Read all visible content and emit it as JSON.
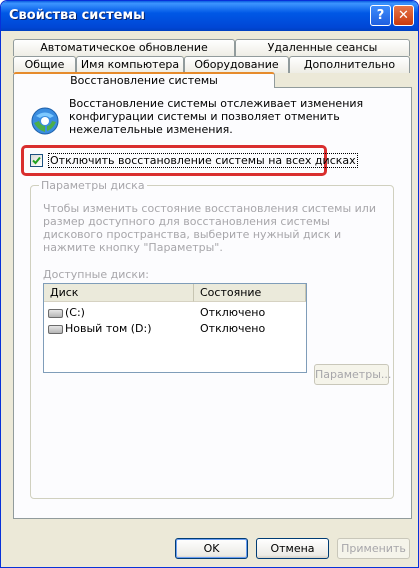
{
  "window": {
    "title": "Свойства системы",
    "help_glyph": "?",
    "close_glyph": "✕"
  },
  "tabs": {
    "row1": [
      "Автоматическое обновление",
      "Удаленные сеансы"
    ],
    "row2": [
      "Общие",
      "Имя компьютера",
      "Оборудование",
      "Дополнительно"
    ],
    "active": "Восстановление системы"
  },
  "panel": {
    "intro_text": "Восстановление системы отслеживает изменения конфигурации системы и позволяет отменить нежелательные изменения.",
    "disable_checkbox": {
      "label": "Отключить восстановление системы на всех дисках",
      "checked": true
    },
    "disk_group": {
      "title": "Параметры диска",
      "description": "Чтобы изменить состояние восстановления системы или размер доступного для восстановления системы дискового пространства, выберите нужный диск и нажмите кнопку \"Параметры\".",
      "available_label": "Доступные диски:",
      "columns": [
        "Диск",
        "Состояние"
      ],
      "rows": [
        {
          "disk": "(C:)",
          "state": "Отключено"
        },
        {
          "disk": "Новый том (D:)",
          "state": "Отключено"
        }
      ],
      "settings_button": "Параметры..."
    }
  },
  "footer": {
    "ok": "OK",
    "cancel": "Отмена",
    "apply": "Применить"
  },
  "colors": {
    "titlebar": "#0058e6",
    "dialog_bg": "#ece9d8",
    "highlight_box": "#d92e2e",
    "disabled_text": "#a7a6aa"
  },
  "icons": [
    "help-icon",
    "close-icon",
    "system-restore-icon",
    "check-icon",
    "hard-drive-icon"
  ]
}
